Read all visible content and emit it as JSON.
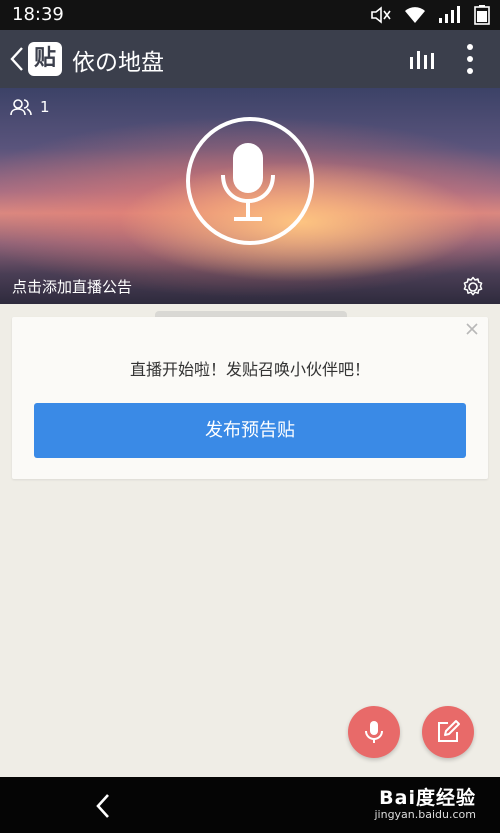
{
  "status_bar": {
    "time": "18:39"
  },
  "app_bar": {
    "logo_text": "贴",
    "title": "依の地盘"
  },
  "live": {
    "listener_count": "1",
    "announcement_label": "点击添加直播公告"
  },
  "prompt_card": {
    "message": "直播开始啦！发贴召唤小伙伴吧！",
    "publish_button": "发布预告贴"
  },
  "watermark": {
    "main": "Bai度经验",
    "sub": "jingyan.baidu.com"
  },
  "colors": {
    "app_bar": "#3b3f4c",
    "primary_button": "#3a8ae6",
    "fab": "#e86a69",
    "page_bg": "#efede6"
  },
  "icons": [
    "volume-muted-icon",
    "wifi-icon",
    "signal-icon",
    "battery-icon",
    "back-icon",
    "signal-bars-icon",
    "more-vertical-icon",
    "users-icon",
    "microphone-icon",
    "settings-gear-icon",
    "close-icon",
    "edit-icon"
  ]
}
